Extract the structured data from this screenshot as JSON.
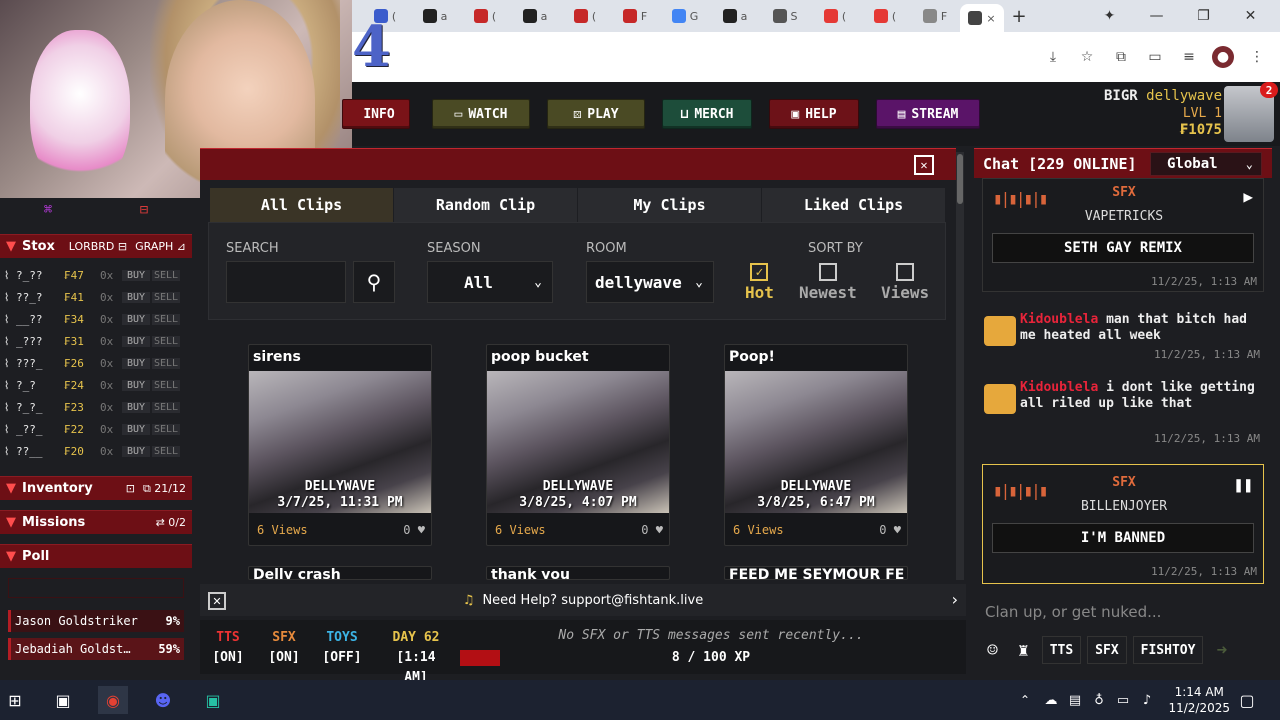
{
  "browser": {
    "tabs": [
      {
        "fav": "#3b5ccc",
        "label": "("
      },
      {
        "fav": "#222",
        "label": "a"
      },
      {
        "fav": "#c62828",
        "label": "("
      },
      {
        "fav": "#222",
        "label": "a"
      },
      {
        "fav": "#c62828",
        "label": "("
      },
      {
        "fav": "#c62828",
        "label": "F"
      },
      {
        "fav": "#4285f4",
        "label": "G"
      },
      {
        "fav": "#222",
        "label": "a"
      },
      {
        "fav": "#555",
        "label": "S"
      },
      {
        "fav": "#e53935",
        "label": "("
      },
      {
        "fav": "#e53935",
        "label": "("
      },
      {
        "fav": "#888",
        "label": "F"
      }
    ],
    "active_tab_close": "×",
    "new_tab": "+"
  },
  "overlay_number": "4",
  "nav": {
    "info": "INFO",
    "watch": "WATCH",
    "play": "PLAY",
    "merch": "MERCH",
    "help": "HELP",
    "stream": "STREAM",
    "colors": {
      "info": "#7a1318",
      "watch": "#4a4a24",
      "play": "#4a4a24",
      "merch": "#1d4d3a",
      "help": "#6d1218",
      "stream": "#5a1468"
    }
  },
  "user": {
    "tag": "BIGR",
    "name": "dellywave",
    "level": "LVL 1",
    "coins": "₣1075",
    "notif_count": "2"
  },
  "stox": {
    "header": "Stox",
    "lorbrd": "LORBRD",
    "graph": "GRAPH",
    "rows": [
      {
        "ticker": "?_??",
        "price": "₣47",
        "qty": "0x"
      },
      {
        "ticker": "??_?",
        "price": "₣41",
        "qty": "0x"
      },
      {
        "ticker": "__??",
        "price": "₣34",
        "qty": "0x"
      },
      {
        "ticker": "_???",
        "price": "₣31",
        "qty": "0x"
      },
      {
        "ticker": "???_",
        "price": "₣26",
        "qty": "0x"
      },
      {
        "ticker": "?_?",
        "price": "₣24",
        "qty": "0x"
      },
      {
        "ticker": "?_?_",
        "price": "₣23",
        "qty": "0x"
      },
      {
        "ticker": "_??_",
        "price": "₣22",
        "qty": "0x"
      },
      {
        "ticker": "??__",
        "price": "₣20",
        "qty": "0x"
      }
    ],
    "buy": "BUY",
    "sell": "SELL"
  },
  "inventory": {
    "label": "Inventory",
    "count": "21/12"
  },
  "missions": {
    "label": "Missions",
    "count": "0/2"
  },
  "poll": {
    "label": "Poll",
    "rows": [
      {
        "name": "Jason Goldstriker",
        "pct": "9%"
      },
      {
        "name": "Jebadiah Goldst…",
        "pct": "59%"
      }
    ]
  },
  "clips": {
    "tabs": [
      "All Clips",
      "Random Clip",
      "My Clips",
      "Liked Clips"
    ],
    "search_label": "SEARCH",
    "season_label": "SEASON",
    "season_value": "All",
    "room_label": "ROOM",
    "room_value": "dellywave",
    "sort_label": "SORT BY",
    "sort_options": [
      "Hot",
      "Newest",
      "Views"
    ],
    "cards": [
      {
        "title": "sirens",
        "wm1": "DELLYWAVE",
        "wm2": "3/7/25, 11:31 PM",
        "views": "6 Views",
        "likes": "0"
      },
      {
        "title": "poop bucket",
        "wm1": "DELLYWAVE",
        "wm2": "3/8/25, 4:07 PM",
        "views": "6 Views",
        "likes": "0"
      },
      {
        "title": "Poop!",
        "wm1": "DELLYWAVE",
        "wm2": "3/8/25, 6:47 PM",
        "views": "6 Views",
        "likes": "0"
      }
    ],
    "partial_titles": [
      "Delly crash",
      "thank you",
      "FEED ME SEYMOUR FE"
    ]
  },
  "help": {
    "text": "Need Help? support@fishtank.live"
  },
  "status": {
    "tts": "TTS",
    "tts_val": "[ON]",
    "sfx": "SFX",
    "sfx_val": "[ON]",
    "toys": "TOYS",
    "toys_val": "[OFF]",
    "day": "DAY 62",
    "day_val": "[1:14 AM]",
    "recent": "No SFX or TTS messages sent recently...",
    "xp": "8 / 100 XP"
  },
  "chat": {
    "title": "Chat [229 ONLINE]",
    "channel": "Global",
    "sfx1": {
      "label": "SFX",
      "user": "VAPETRICKS",
      "title": "SETH GAY REMIX",
      "time": "11/2/25, 1:13 AM"
    },
    "msgs": [
      {
        "name": "Kidoublela",
        "text": " man that bitch had me heated all week",
        "time": "11/2/25, 1:13 AM"
      },
      {
        "name": "Kidoublela",
        "text": " i dont like getting all riled up like that",
        "time": "11/2/25, 1:13 AM"
      }
    ],
    "sfx2": {
      "label": "SFX",
      "user": "BILLENJOYER",
      "title": "I'M BANNED",
      "time": "11/2/25, 1:13 AM"
    },
    "placeholder": "Clan up, or get nuked...",
    "tools": {
      "tts": "TTS",
      "sfx": "SFX",
      "fishtoy": "FISHTOY"
    }
  },
  "taskbar": {
    "time": "1:14 AM",
    "date": "11/2/2025"
  }
}
